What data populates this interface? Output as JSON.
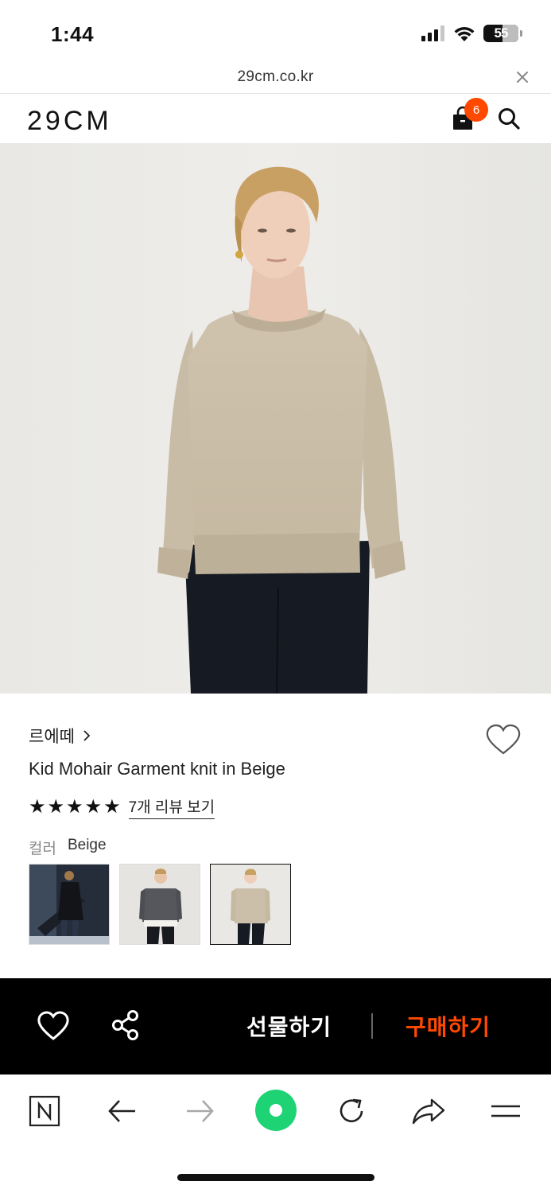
{
  "status_bar": {
    "time": "1:44",
    "battery": "55",
    "icons": [
      "cellular-signal-icon",
      "wifi-icon",
      "battery-icon"
    ]
  },
  "url_bar": {
    "url": "29cm.co.kr",
    "close_icon": "close-icon"
  },
  "header": {
    "logo": "29CM",
    "cart_count": "6",
    "icons": [
      "shopping-bag-icon",
      "search-icon"
    ]
  },
  "product": {
    "brand": "르에떼",
    "name": "Kid Mohair Garment knit in Beige",
    "rating_stars": 5,
    "review_link": "7개 리뷰 보기",
    "color_label": "컬러",
    "color_value": "Beige",
    "swatches": [
      {
        "color": "Black",
        "selected": false
      },
      {
        "color": "Charcoal",
        "selected": false
      },
      {
        "color": "Beige",
        "selected": true
      }
    ]
  },
  "action_bar": {
    "gift_label": "선물하기",
    "buy_label": "구매하기",
    "buy_color": "#ff4800",
    "icons": [
      "heart-icon",
      "share-icon"
    ]
  },
  "browser_toolbar": {
    "icons": [
      "naver-n-icon",
      "back-arrow-icon",
      "forward-arrow-icon",
      "green-dot-icon",
      "reload-icon",
      "share-arrow-icon",
      "menu-icon"
    ]
  },
  "colors": {
    "accent": "#ff4800",
    "action_bar_bg": "#000000"
  }
}
